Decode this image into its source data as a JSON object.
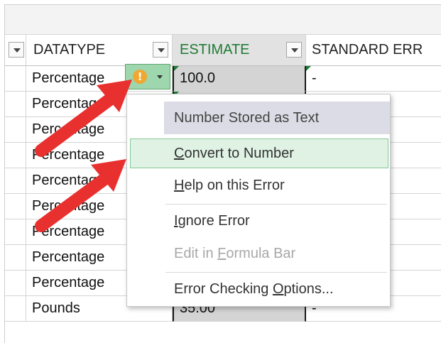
{
  "headers": {
    "datatype": "DATATYPE",
    "estimate": "ESTIMATE",
    "standard_error": "STANDARD ERR"
  },
  "rows": [
    {
      "datatype": "Percentage",
      "estimate": "100.0",
      "std_error": "-"
    },
    {
      "datatype": "Percentage",
      "estimate": "",
      "std_error": ""
    },
    {
      "datatype": "Percentage",
      "estimate": "",
      "std_error": ""
    },
    {
      "datatype": "Percentage",
      "estimate": "",
      "std_error": ""
    },
    {
      "datatype": "Percentage",
      "estimate": "",
      "std_error": ""
    },
    {
      "datatype": "Percentage",
      "estimate": "",
      "std_error": ""
    },
    {
      "datatype": "Percentage",
      "estimate": "",
      "std_error": ""
    },
    {
      "datatype": "Percentage",
      "estimate": "",
      "std_error": ""
    },
    {
      "datatype": "Percentage",
      "estimate": "",
      "std_error": ""
    },
    {
      "datatype": "Pounds",
      "estimate": "35.00",
      "std_error": "-"
    }
  ],
  "smart_tag": {
    "icon": "warning-icon",
    "glyph": "!"
  },
  "context_menu": {
    "title": "Number Stored as Text",
    "convert": {
      "pre": "",
      "key": "C",
      "post": "onvert to Number"
    },
    "help": {
      "pre": "",
      "key": "H",
      "post": "elp on this Error"
    },
    "ignore": {
      "pre": "",
      "key": "I",
      "post": "gnore Error"
    },
    "edit_formula": {
      "pre": "Edit in ",
      "key": "F",
      "post": "ormula Bar"
    },
    "options": {
      "pre": "Error Checking ",
      "key": "O",
      "post": "ptions..."
    }
  },
  "colors": {
    "annotation_arrow": "#e8302f",
    "highlight": "#dff2e4",
    "cell_selected": "#d4d4d4",
    "error_triangle": "#1e7b34"
  }
}
